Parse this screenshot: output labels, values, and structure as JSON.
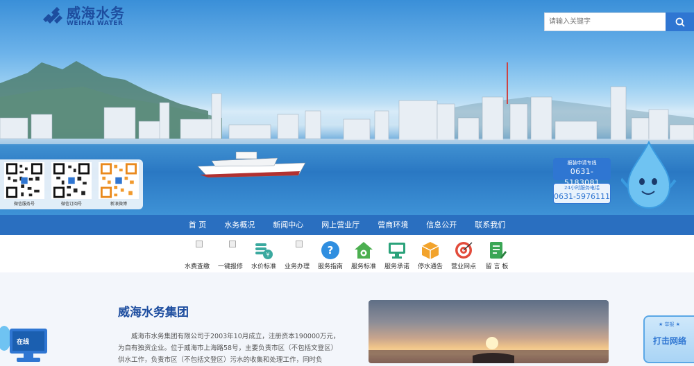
{
  "header": {
    "logo_cn": "威海水务",
    "logo_en": "WEIHAI WATER",
    "search_placeholder": "请输入关键字"
  },
  "qr_codes": [
    {
      "label": "微信服务号"
    },
    {
      "label": "微信订阅号"
    },
    {
      "label": "新浪微博"
    }
  ],
  "hotline": {
    "install_title": "报装申请专线",
    "install_number": "0631-5183081",
    "service_title": "24小时服务电话",
    "service_number": "0631-5976111"
  },
  "nav": {
    "items": [
      "首 页",
      "水务概况",
      "新闻中心",
      "网上营业厅",
      "营商环境",
      "信息公开",
      "联系我们"
    ]
  },
  "services": [
    {
      "label": "水费查缴",
      "icon": "broken-image-icon"
    },
    {
      "label": "一键报修",
      "icon": "broken-image-icon"
    },
    {
      "label": "水价标准",
      "icon": "coins-icon"
    },
    {
      "label": "业务办理",
      "icon": "broken-image-icon"
    },
    {
      "label": "服务指南",
      "icon": "question-icon"
    },
    {
      "label": "服务标准",
      "icon": "house-gear-icon"
    },
    {
      "label": "服务承诺",
      "icon": "monitor-icon"
    },
    {
      "label": "停水通告",
      "icon": "box-icon"
    },
    {
      "label": "营业网点",
      "icon": "target-icon"
    },
    {
      "label": "留 言 板",
      "icon": "document-pen-icon"
    }
  ],
  "about": {
    "title": "威海水务集团",
    "text": "威海市水务集团有限公司于2003年10月成立，注册资本190000万元，为自有独资企业。位于威海市上海路58号，主要负责市区（不包括文登区）供水工作，负责市区（不包括文登区）污水的收集和处理工作，同时负"
  },
  "floating": {
    "left_label": "在线",
    "right_small": "★ 举报 ★",
    "right_big": "打击网络"
  },
  "colors": {
    "brand": "#1d4d9f",
    "nav": "#2a6fc0",
    "accent": "#2f76d2"
  }
}
